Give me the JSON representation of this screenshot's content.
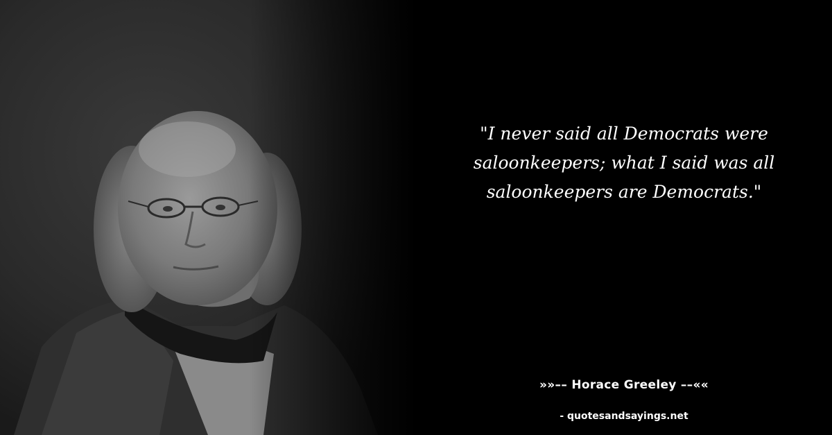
{
  "quote": {
    "text": "\"I never said all Democrats were saloonkeepers; what I said was all saloonkeepers are Democrats.\""
  },
  "author": {
    "line": "»»–– Horace Greeley ––««"
  },
  "footer": {
    "site": "- quotesandsayings.net"
  },
  "portrait": {
    "subject": "portrait-photo"
  }
}
